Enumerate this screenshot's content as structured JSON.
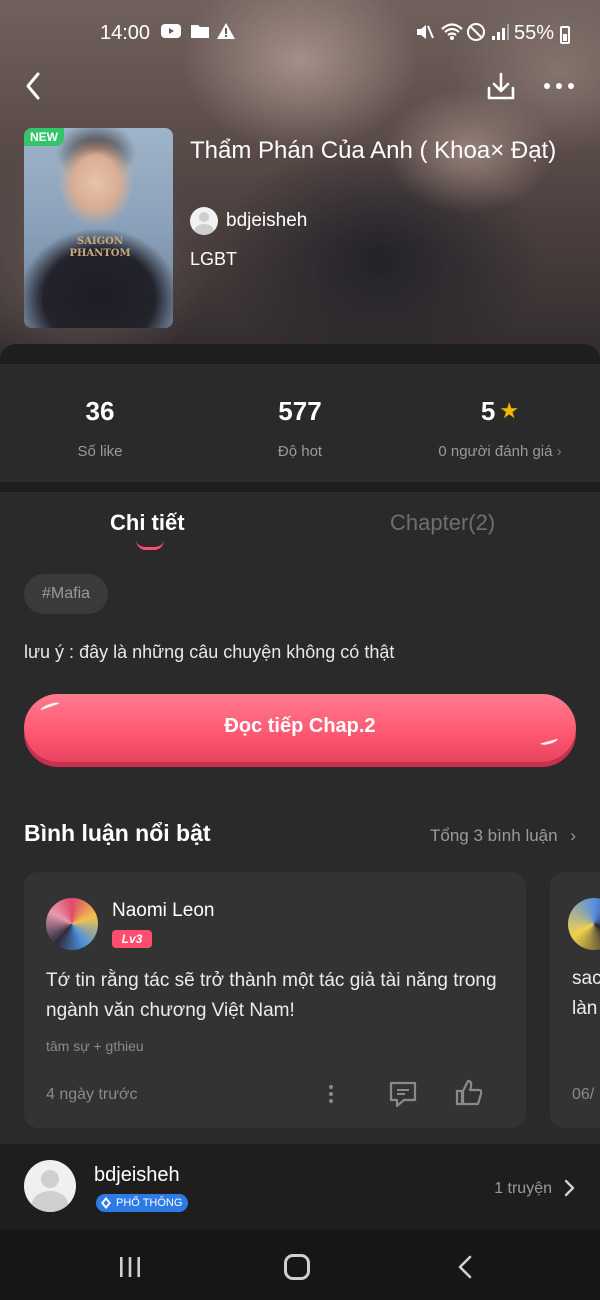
{
  "status_bar": {
    "time": "14:00",
    "battery": "55%",
    "icons": [
      "youtube-icon",
      "folder-icon",
      "warning-icon",
      "mute-icon",
      "wifi-icon",
      "dnd-icon",
      "signal-icon",
      "battery-icon"
    ]
  },
  "story": {
    "badge": "NEW",
    "title": "Thẩm Phán Của Anh ( Khoa× Đạt)",
    "author": "bdjeisheh",
    "genre": "LGBT",
    "cover_text": [
      "SAIGON",
      "PHANTOM"
    ]
  },
  "stats": [
    {
      "value": "36",
      "label": "Số like"
    },
    {
      "value": "577",
      "label": "Độ hot"
    },
    {
      "value": "5",
      "label": "0 người đánh giá"
    }
  ],
  "tabs": [
    {
      "label": "Chi tiết",
      "active": true
    },
    {
      "label": "Chapter(2)",
      "active": false
    }
  ],
  "tag": "#Mafia",
  "description": "lưu ý : đây là những câu chuyện không có thật",
  "read_button": "Đọc tiếp Chap.2",
  "comments": {
    "title": "Bình luận nổi bật",
    "total": "Tổng 3 bình luận",
    "items": [
      {
        "name": "Naomi Leon",
        "level": "Lv3",
        "text": "Tớ tin rằng tác sẽ trở thành một tác giả tài năng trong ngành văn chương Việt Nam!",
        "sub": "tâm sự + gthieu",
        "time": "4 ngày trước"
      },
      {
        "text_line1": "sac",
        "text_line2": "làn",
        "time": "06/"
      }
    ]
  },
  "author_section": {
    "name": "bdjeisheh",
    "rank": "PHỔ THÔNG",
    "count": "1 truyện"
  },
  "colors": {
    "accent": "#ff5a74",
    "background": "#1e1e1e",
    "card": "#333333",
    "star": "#f5b800",
    "new_badge": "#34c46a"
  }
}
